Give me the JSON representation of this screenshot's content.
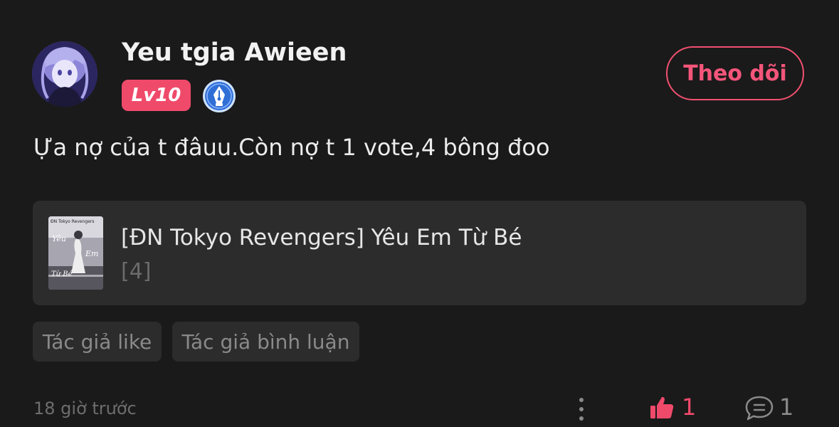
{
  "comment": {
    "author": {
      "name": "Yeu tgia Awieen",
      "level_badge": "Lv10",
      "avatar_icon": "anime-avatar",
      "writer_badge_icon": "pen-nib-badge-icon"
    },
    "follow_button_label": "Theo dõi",
    "text": "Ựa nợ của t đâuu.Còn nợ t 1 vote,4 bông đoo",
    "story": {
      "title": "[ĐN Tokyo Revengers] Yêu Em Từ Bé",
      "chapter": "[4]",
      "cover_text": {
        "top": "ĐN Tokyo Revengers",
        "line1": "Yêu",
        "line2": "Em",
        "line3": "Từ Bé"
      }
    },
    "tags": [
      "Tác giả like",
      "Tác giả bình luận"
    ],
    "timestamp": "18 giờ trước",
    "likes": "1",
    "replies": "1"
  },
  "colors": {
    "background": "#1a1a1a",
    "accent": "#f04a6b",
    "card": "#2c2c2c",
    "muted_text": "#8a8a8a"
  }
}
